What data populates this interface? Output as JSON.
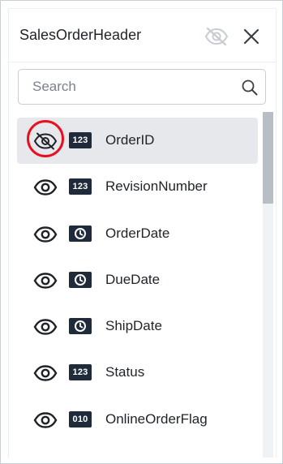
{
  "panel": {
    "title": "SalesOrderHeader",
    "search_placeholder": "Search",
    "search_value": ""
  },
  "icons": {
    "hide_all": "eye-slash-icon",
    "close": "close-icon",
    "search": "search-icon"
  },
  "fields": [
    {
      "name": "OrderID",
      "type_icon": "number-type-icon",
      "type_label": "123",
      "visible": false,
      "selected": true
    },
    {
      "name": "RevisionNumber",
      "type_icon": "number-type-icon",
      "type_label": "123",
      "visible": true,
      "selected": false
    },
    {
      "name": "OrderDate",
      "type_icon": "datetime-type-icon",
      "type_label": "",
      "visible": true,
      "selected": false
    },
    {
      "name": "DueDate",
      "type_icon": "datetime-type-icon",
      "type_label": "",
      "visible": true,
      "selected": false
    },
    {
      "name": "ShipDate",
      "type_icon": "datetime-type-icon",
      "type_label": "",
      "visible": true,
      "selected": false
    },
    {
      "name": "Status",
      "type_icon": "number-type-icon",
      "type_label": "123",
      "visible": true,
      "selected": false
    },
    {
      "name": "OnlineOrderFlag",
      "type_icon": "boolean-type-icon",
      "type_label": "010",
      "visible": true,
      "selected": false
    }
  ],
  "colors": {
    "selected_row": "#e6e8ec",
    "type_badge": "#1f2a3a",
    "highlight_ring": "#e8101e",
    "scroll_thumb": "#b9bdc4"
  }
}
